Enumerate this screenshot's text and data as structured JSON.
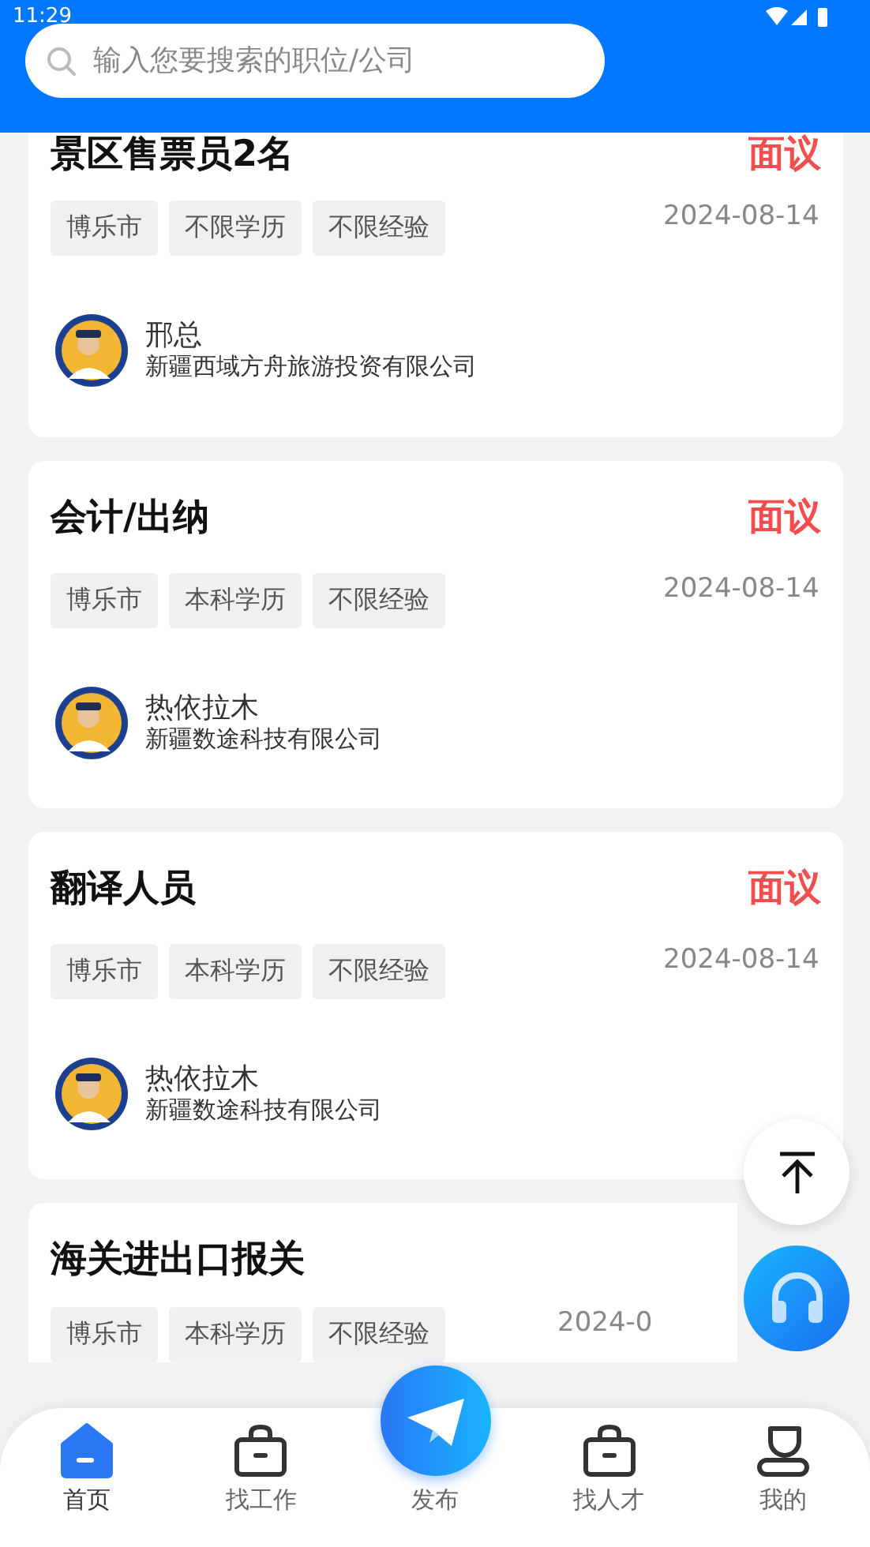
{
  "status_bar": {
    "time": "11:29"
  },
  "search": {
    "placeholder": "输入您要搜索的职位/公司"
  },
  "jobs": [
    {
      "title": "景区售票员2名",
      "salary": "面议",
      "tags": [
        "博乐市",
        "不限学历",
        "不限经验"
      ],
      "date": "2024-08-14",
      "contact": {
        "name": "邢总",
        "company": "新疆西域方舟旅游投资有限公司"
      }
    },
    {
      "title": "会计/出纳",
      "salary": "面议",
      "tags": [
        "博乐市",
        "本科学历",
        "不限经验"
      ],
      "date": "2024-08-14",
      "contact": {
        "name": "热依拉木",
        "company": "新疆数途科技有限公司"
      }
    },
    {
      "title": "翻译人员",
      "salary": "面议",
      "tags": [
        "博乐市",
        "本科学历",
        "不限经验"
      ],
      "date": "2024-08-14",
      "contact": {
        "name": "热依拉木",
        "company": "新疆数途科技有限公司"
      }
    },
    {
      "title": "海关进出口报关",
      "tags": [
        "博乐市",
        "本科学历",
        "不限经验"
      ],
      "date": "2024-0"
    }
  ],
  "tab_bar": [
    {
      "kind": "home",
      "label": "首页",
      "selected": true
    },
    {
      "kind": "bag",
      "label": "找工作",
      "selected": false
    },
    {
      "kind": "publish",
      "label": "发布",
      "selected": false
    },
    {
      "kind": "bag",
      "label": "找人才",
      "selected": false
    },
    {
      "kind": "user",
      "label": "我的",
      "selected": false
    }
  ]
}
